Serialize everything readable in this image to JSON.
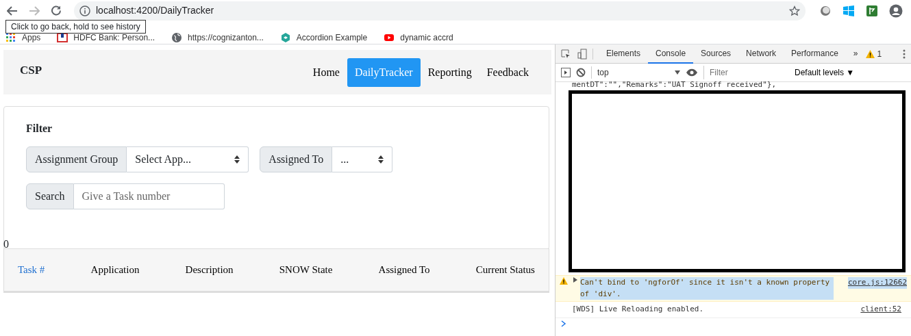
{
  "browser": {
    "back": {
      "disabled": false
    },
    "forward": {
      "disabled": true
    },
    "url": "localhost:4200/DailyTracker",
    "tooltip": "Click to go back, hold to see history",
    "bookmarks": [
      {
        "kind": "apps",
        "label": "Apps"
      },
      {
        "kind": "bank",
        "label": "HDFC Bank: Person..."
      },
      {
        "kind": "globe",
        "label": "https://cognizanton..."
      },
      {
        "kind": "hex",
        "label": "Accordion Example"
      },
      {
        "kind": "video",
        "label": "dynamic accrd"
      }
    ]
  },
  "app": {
    "brand": "CSP",
    "nav": [
      {
        "label": "Home",
        "selected": false
      },
      {
        "label": "DailyTracker",
        "selected": true
      },
      {
        "label": "Reporting",
        "selected": false
      },
      {
        "label": "Feedback",
        "selected": false
      }
    ],
    "filter": {
      "title": "Filter",
      "selects": [
        {
          "label": "Assignment Group",
          "value": "Select App..."
        },
        {
          "label": "Assigned To",
          "value": "..."
        }
      ],
      "search": {
        "label": "Search",
        "placeholder": "Give a Task number"
      }
    },
    "count": "0",
    "table": {
      "columns": [
        {
          "label": "Task #",
          "link": true
        },
        {
          "label": "Application",
          "link": false
        },
        {
          "label": "Description",
          "link": false
        },
        {
          "label": "SNOW State",
          "link": false
        },
        {
          "label": "Assigned To",
          "link": false
        },
        {
          "label": "Current Status",
          "link": false
        }
      ]
    }
  },
  "devtools": {
    "tabs": [
      {
        "label": "Elements",
        "selected": false
      },
      {
        "label": "Console",
        "selected": true
      },
      {
        "label": "Sources",
        "selected": false
      },
      {
        "label": "Network",
        "selected": false
      },
      {
        "label": "Performance",
        "selected": false
      }
    ],
    "more": "»",
    "warning_count": "1",
    "context": "top",
    "filter_placeholder": "Filter",
    "levels": "Default levels ▼",
    "messages": [
      {
        "kind": "log",
        "text": "mentDT\":\"\",\"Remarks\":\"UAT Signoff received\"},"
      },
      {
        "kind": "warning",
        "text": "Can't bind to 'ngforOf' since it isn't a known property of 'div'.",
        "source": "core.js:12662"
      },
      {
        "kind": "log",
        "text": "[WDS] Live Reloading enabled.",
        "source": "client:52"
      }
    ]
  }
}
